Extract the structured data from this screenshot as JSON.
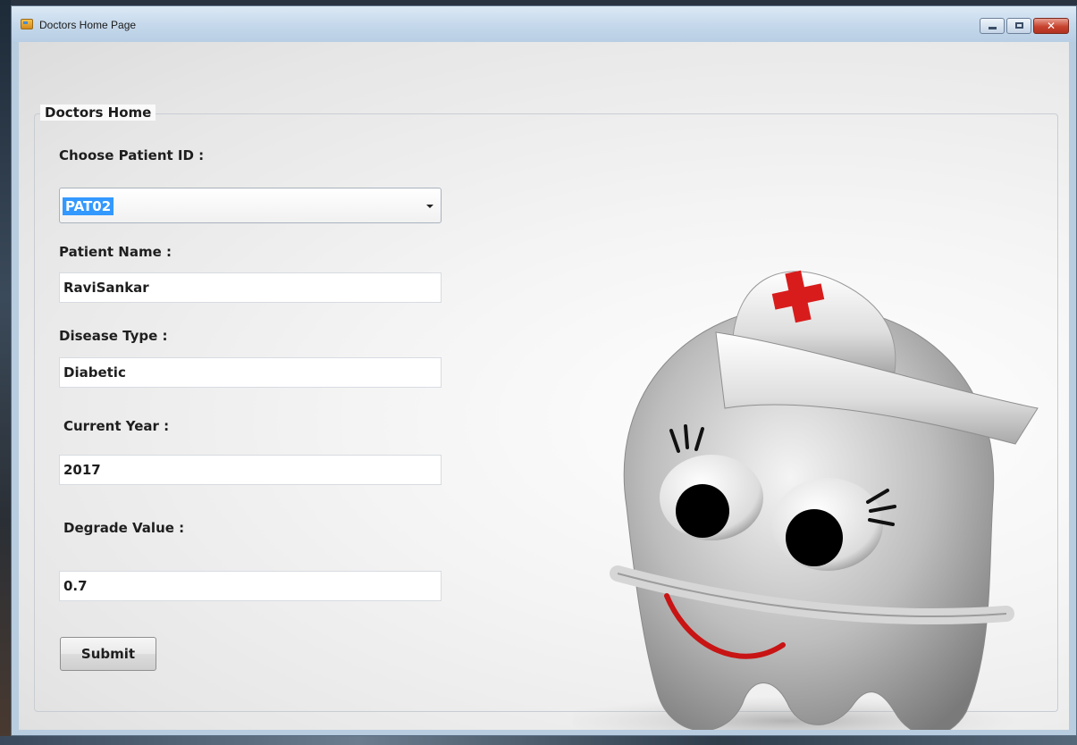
{
  "window": {
    "title": "Doctors Home Page",
    "close_glyph": "✕"
  },
  "group": {
    "legend": "Doctors Home"
  },
  "form": {
    "patient_id_label": "Choose Patient ID :",
    "patient_id_value": "PAT02",
    "patient_name_label": "Patient Name :",
    "patient_name_value": "RaviSankar",
    "disease_type_label": "Disease Type :",
    "disease_type_value": "Diabetic",
    "current_year_label": "Current Year :",
    "current_year_value": "2017",
    "degrade_value_label": "Degrade Value :",
    "degrade_value_value": "0.7",
    "submit_label": "Submit"
  },
  "colors": {
    "selection": "#3399ff",
    "cross": "#d81c1c",
    "smile": "#c81414"
  },
  "icons": {
    "app": "window-icon",
    "mascot": "nurse-tooth-mascot"
  }
}
